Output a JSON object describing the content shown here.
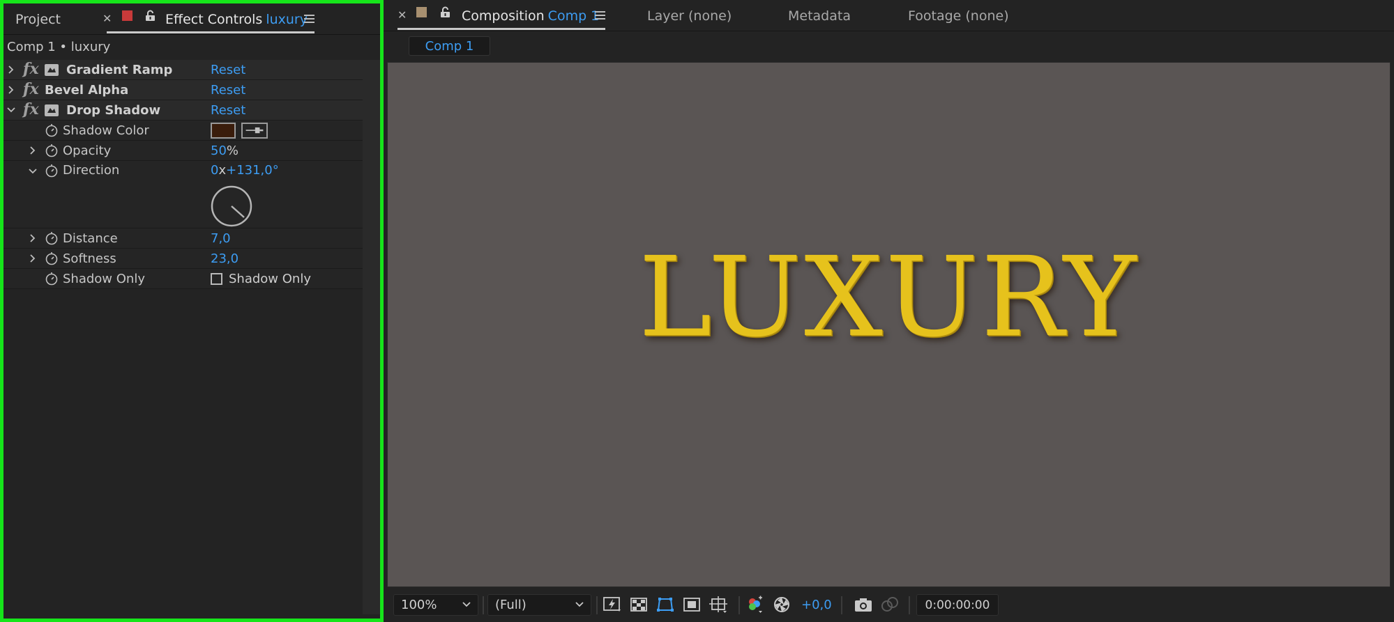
{
  "left_panel": {
    "tabs": {
      "project": "Project",
      "effect_controls_prefix": "Effect Controls",
      "effect_controls_layer": "luxury"
    },
    "breadcrumb": "Comp 1 • luxury",
    "label_color": "#c83a3a",
    "effects": [
      {
        "name": "Gradient Ramp",
        "reset": "Reset"
      },
      {
        "name": "Bevel Alpha",
        "reset": "Reset"
      },
      {
        "name": "Drop Shadow",
        "reset": "Reset"
      }
    ],
    "properties": {
      "shadow_color": {
        "label": "Shadow Color",
        "color": "#3a1d0c"
      },
      "opacity": {
        "label": "Opacity",
        "value": "50",
        "unit": "%"
      },
      "direction": {
        "label": "Direction",
        "revolutions": "0",
        "sep": "x",
        "angle": "+131,0°"
      },
      "distance": {
        "label": "Distance",
        "value": "7,0"
      },
      "softness": {
        "label": "Softness",
        "value": "23,0"
      },
      "shadow_only": {
        "label": "Shadow Only",
        "checkbox_label": "Shadow Only",
        "checked": false
      }
    }
  },
  "right_panel": {
    "tabs": {
      "composition_prefix": "Composition",
      "composition_name": "Comp 1",
      "layer": "Layer (none)",
      "metadata": "Metadata",
      "footage": "Footage (none)"
    },
    "label_color": "#a89070",
    "comp_chip": "Comp 1",
    "canvas_text": "LUXURY",
    "canvas_bg": "#5a5554",
    "text_color": "#e6c21c"
  },
  "bottom_bar": {
    "zoom": "100%",
    "resolution": "(Full)",
    "exposure": "+0,0",
    "timecode": "0:00:00:00"
  },
  "accent_blue": "#3d9df3",
  "highlight_border": "#16e51a"
}
